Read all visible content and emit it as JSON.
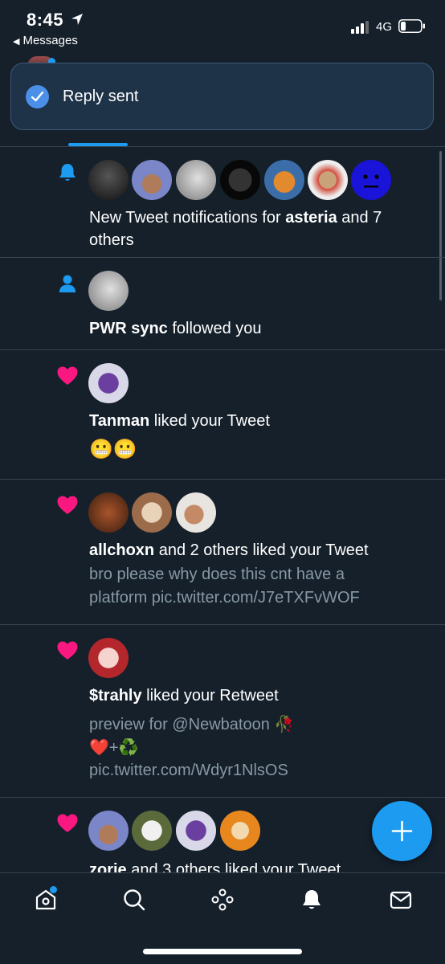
{
  "status_bar": {
    "time": "8:45",
    "back_label": "Messages",
    "network": "4G"
  },
  "toast": {
    "text": "Reply sent",
    "icon": "check-icon"
  },
  "colors": {
    "background": "#15202b",
    "accent": "#1d9bf0",
    "like": "#f91880",
    "muted_text": "#8899a6",
    "divider": "#38444d"
  },
  "notifications": [
    {
      "type": "new-tweets",
      "icon": "bell-icon",
      "user": "asteria",
      "prefix": "New Tweet notifications for ",
      "suffix": " and 7 others"
    },
    {
      "type": "follow",
      "icon": "person-icon",
      "user": "PWR sync",
      "action": " followed you"
    },
    {
      "type": "like",
      "icon": "heart-icon",
      "user": "Tanman",
      "action": " liked your Tweet",
      "content": "😬😬"
    },
    {
      "type": "like",
      "icon": "heart-icon",
      "user": "allchoxn",
      "action": " and 2 others liked your Tweet",
      "content": "bro please why does this cnt have a platform pic.twitter.com/J7eTXFvWOF"
    },
    {
      "type": "like",
      "icon": "heart-icon",
      "user": "$trahly",
      "action": " liked your Retweet",
      "content_line1": "preview for @Newbatoon 🥀",
      "content_line2": "❤️+♻️",
      "content_line3": "pic.twitter.com/Wdyr1NlsOS"
    },
    {
      "type": "like",
      "icon": "heart-icon",
      "user": "zorie",
      "action": " and 3 others liked your Tweet"
    }
  ],
  "fab": {
    "icon": "plus-icon"
  },
  "bottom_nav": [
    "home-icon",
    "search-icon",
    "spaces-icon",
    "bell-icon",
    "mail-icon"
  ]
}
